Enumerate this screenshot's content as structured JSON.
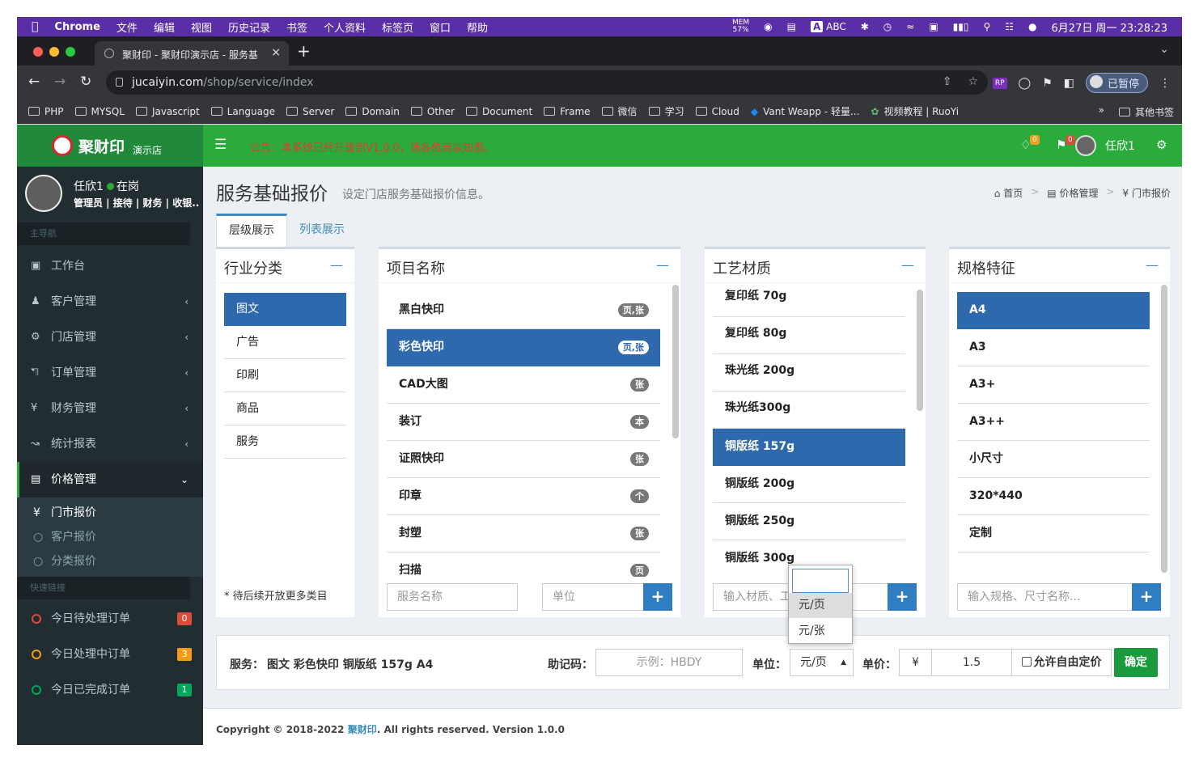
{
  "macbar": {
    "app": "Chrome",
    "menus": [
      "文件",
      "编辑",
      "视图",
      "历史记录",
      "书签",
      "个人资料",
      "标签页",
      "窗口",
      "帮助"
    ],
    "mem": "MEM",
    "mem_pct": "57%",
    "input": "ABC",
    "datetime": "6月27日 周一 23:28:23"
  },
  "browser": {
    "tab_title": "聚财印 - 聚财印演示店 - 服务基",
    "url_host": "jucaiyin.com",
    "url_path": "/shop/service/index",
    "paused_label": "已暂停",
    "bookmarks": [
      "PHP",
      "MYSQL",
      "Javascript",
      "Language",
      "Server",
      "Domain",
      "Other",
      "Document",
      "Frame",
      "微信",
      "学习",
      "Cloud",
      "Vant Weapp - 轻量...",
      "视频教程 | RuoYi"
    ],
    "more": "»",
    "other_bookmarks": "其他书签"
  },
  "header": {
    "logo_name": "聚财印",
    "logo_sub": "演示店",
    "notice": "公告：本系统已经升级到V1.0.0，请各位商家知悉。",
    "bell_count": "0",
    "flag_count": "0",
    "user_name": "任欣1"
  },
  "sidebar": {
    "user_name": "任欣1",
    "status": "在岗",
    "roles": "管理员 | 接待 | 财务 | 收银...",
    "main_nav_label": "主导航",
    "items": [
      {
        "label": "工作台",
        "icon": "monitor-icon"
      },
      {
        "label": "客户管理",
        "icon": "user-icon"
      },
      {
        "label": "门店管理",
        "icon": "cogs-icon"
      },
      {
        "label": "订单管理",
        "icon": "cart-icon"
      },
      {
        "label": "财务管理",
        "icon": "yen-icon"
      },
      {
        "label": "统计报表",
        "icon": "chart-icon"
      },
      {
        "label": "价格管理",
        "icon": "money-icon"
      }
    ],
    "sub_items": [
      "门市报价",
      "客户报价",
      "分类报价"
    ],
    "quick_label": "快速链接",
    "quick": [
      {
        "label": "今日待处理订单",
        "count": "0",
        "color": "#dd4b39"
      },
      {
        "label": "今日处理中订单",
        "count": "3",
        "color": "#f39c12"
      },
      {
        "label": "今日已完成订单",
        "count": "1",
        "color": "#00a65a"
      }
    ]
  },
  "page": {
    "title": "服务基础报价",
    "subtitle": "设定门店服务基础报价信息。",
    "breadcrumb": [
      "首页",
      "价格管理",
      "¥ 门市报价"
    ],
    "tabs": [
      "层级展示",
      "列表展示"
    ]
  },
  "panels": {
    "industry": {
      "title": "行业分类",
      "items": [
        "图文",
        "广告",
        "印刷",
        "商品",
        "服务"
      ],
      "note": "* 待后续开放更多类目"
    },
    "project": {
      "title": "项目名称",
      "items": [
        {
          "name": "黑白快印",
          "unit": "页,张"
        },
        {
          "name": "彩色快印",
          "unit": "页,张"
        },
        {
          "name": "CAD大图",
          "unit": "张"
        },
        {
          "name": "装订",
          "unit": "本"
        },
        {
          "name": "证照快印",
          "unit": "张"
        },
        {
          "name": "印章",
          "unit": "个"
        },
        {
          "name": "封塑",
          "unit": "张"
        },
        {
          "name": "扫描",
          "unit": "页"
        }
      ],
      "name_placeholder": "服务名称",
      "unit_placeholder": "单位"
    },
    "material": {
      "title": "工艺材质",
      "items": [
        "复印纸 70g",
        "复印纸 80g",
        "珠光纸 200g",
        "珠光纸300g",
        "铜版纸 157g",
        "铜版纸 200g",
        "铜版纸 250g",
        "铜版纸 300g"
      ],
      "placeholder": "输入材质、工"
    },
    "spec": {
      "title": "规格特征",
      "items": [
        "A4",
        "A3",
        "A3+",
        "A3++",
        "小尺寸",
        "320*440",
        "定制"
      ],
      "placeholder": "输入规格、尺寸名称..."
    }
  },
  "form": {
    "service_label": "服务：",
    "service_value": "图文 彩色快印 铜版纸 157g A4",
    "mnemonic_label": "助记码：",
    "mnemonic_placeholder": "示例：HBDY",
    "unit_label": "单位：",
    "unit_value": "元/页",
    "price_label": "单价：",
    "currency": "¥",
    "price_value": "1.5",
    "free_price_label": "允许自由定价",
    "confirm": "确定",
    "unit_options": [
      "元/页",
      "元/张"
    ]
  },
  "footer": {
    "prefix": "Copyright © 2018-2022 ",
    "brand": "聚财印",
    "suffix": ". All rights reserved. Version 1.0.0"
  }
}
